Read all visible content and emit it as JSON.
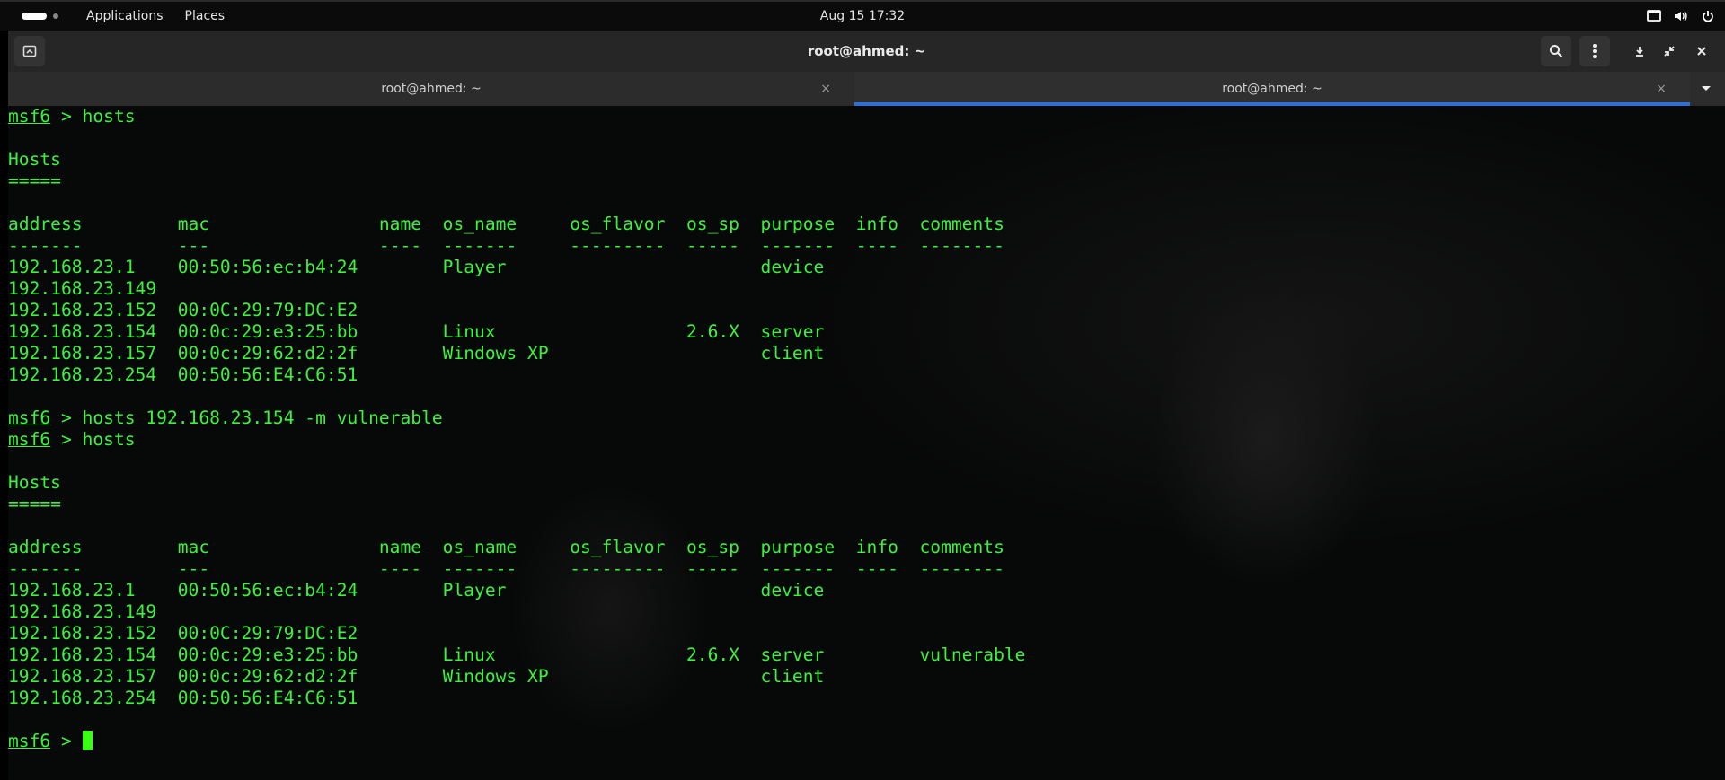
{
  "topbar": {
    "applications": "Applications",
    "places": "Places",
    "clock": "Aug 15  17:32"
  },
  "window": {
    "title": "root@ahmed: ~",
    "tabs": [
      {
        "label": "root@ahmed: ~",
        "close": "×"
      },
      {
        "label": "root@ahmed: ~",
        "close": "×"
      }
    ]
  },
  "icons": {
    "new_tab": "new-tab-icon",
    "search": "search-icon",
    "menu": "kebab-menu-icon",
    "minimize": "minimize-icon",
    "restore": "restore-icon",
    "close": "close-icon",
    "tab_list": "chevron-down-icon",
    "screen": "screen-icon",
    "volume": "volume-icon",
    "power": "power-icon"
  },
  "colors": {
    "terminal_text": "#3df23d",
    "tab_underline": "#2f6fd6",
    "cursor": "#39ff14"
  },
  "terminal": {
    "prompt": "msf6",
    "lines": [
      {
        "prompt": "msf6",
        "text": " > hosts"
      },
      {
        "text": ""
      },
      {
        "text": "Hosts"
      },
      {
        "text": "====="
      },
      {
        "text": ""
      },
      {
        "text": "address         mac                name  os_name     os_flavor  os_sp  purpose  info  comments"
      },
      {
        "text": "-------         ---                ----  -------     ---------  -----  -------  ----  --------"
      },
      {
        "text": "192.168.23.1    00:50:56:ec:b4:24        Player                        device"
      },
      {
        "text": "192.168.23.149"
      },
      {
        "text": "192.168.23.152  00:0C:29:79:DC:E2"
      },
      {
        "text": "192.168.23.154  00:0c:29:e3:25:bb        Linux                  2.6.X  server"
      },
      {
        "text": "192.168.23.157  00:0c:29:62:d2:2f        Windows XP                    client"
      },
      {
        "text": "192.168.23.254  00:50:56:E4:C6:51"
      },
      {
        "text": ""
      },
      {
        "prompt": "msf6",
        "text": " > hosts 192.168.23.154 -m vulnerable"
      },
      {
        "prompt": "msf6",
        "text": " > hosts"
      },
      {
        "text": ""
      },
      {
        "text": "Hosts"
      },
      {
        "text": "====="
      },
      {
        "text": ""
      },
      {
        "text": "address         mac                name  os_name     os_flavor  os_sp  purpose  info  comments"
      },
      {
        "text": "-------         ---                ----  -------     ---------  -----  -------  ----  --------"
      },
      {
        "text": "192.168.23.1    00:50:56:ec:b4:24        Player                        device"
      },
      {
        "text": "192.168.23.149"
      },
      {
        "text": "192.168.23.152  00:0C:29:79:DC:E2"
      },
      {
        "text": "192.168.23.154  00:0c:29:e3:25:bb        Linux                  2.6.X  server         vulnerable"
      },
      {
        "text": "192.168.23.157  00:0c:29:62:d2:2f        Windows XP                    client"
      },
      {
        "text": "192.168.23.254  00:50:56:E4:C6:51"
      },
      {
        "text": ""
      },
      {
        "prompt": "msf6",
        "text": " > ",
        "cursor": true
      }
    ]
  }
}
